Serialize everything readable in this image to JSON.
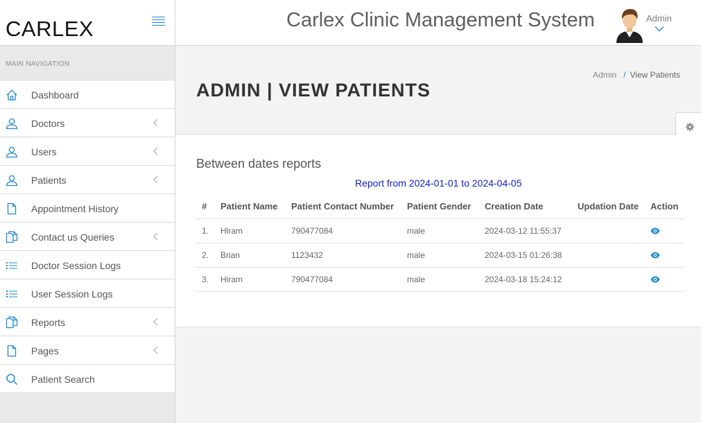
{
  "brand": {
    "name": "CARLEX"
  },
  "header": {
    "app_title": "Carlex Clinic Management System",
    "user_name": "Admin"
  },
  "sidebar": {
    "section_title": "MAIN NAVIGATION",
    "items": [
      {
        "label": "Dashboard",
        "icon": "home-icon",
        "has_submenu": false
      },
      {
        "label": "Doctors",
        "icon": "user-icon",
        "has_submenu": true
      },
      {
        "label": "Users",
        "icon": "user-icon",
        "has_submenu": true
      },
      {
        "label": "Patients",
        "icon": "user-icon",
        "has_submenu": true
      },
      {
        "label": "Appointment History",
        "icon": "file-icon",
        "has_submenu": false
      },
      {
        "label": "Contact us Queries",
        "icon": "files-icon",
        "has_submenu": true
      },
      {
        "label": "Doctor Session Logs",
        "icon": "list-icon",
        "has_submenu": false
      },
      {
        "label": "User Session Logs",
        "icon": "list-icon",
        "has_submenu": false
      },
      {
        "label": "Reports",
        "icon": "files-icon",
        "has_submenu": true
      },
      {
        "label": "Pages",
        "icon": "file-icon",
        "has_submenu": true
      },
      {
        "label": "Patient Search",
        "icon": "search-icon",
        "has_submenu": false
      }
    ]
  },
  "page": {
    "title": "ADMIN | VIEW PATIENTS",
    "breadcrumb": {
      "root": "Admin",
      "separator": "/",
      "current": "View Patients"
    }
  },
  "report": {
    "section_title": "Between dates reports",
    "range_text": "Report from 2024-01-01 to 2024-04-05",
    "columns": [
      "#",
      "Patient Name",
      "Patient Contact Number",
      "Patient Gender",
      "Creation Date",
      "Updation Date",
      "Action"
    ],
    "rows": [
      {
        "num": "1.",
        "name": "Hlram",
        "contact": "790477084",
        "gender": "male",
        "created": "2024-03-12 11:55:37",
        "updated": ""
      },
      {
        "num": "2.",
        "name": "Brian",
        "contact": "1123432",
        "gender": "male",
        "created": "2024-03-15 01:26:38",
        "updated": ""
      },
      {
        "num": "3.",
        "name": "Hiram",
        "contact": "790477084",
        "gender": "male",
        "created": "2024-03-18 15:24:12",
        "updated": ""
      }
    ]
  },
  "colors": {
    "accent": "#1d8ad6",
    "report_range": "#0d1ec6"
  }
}
